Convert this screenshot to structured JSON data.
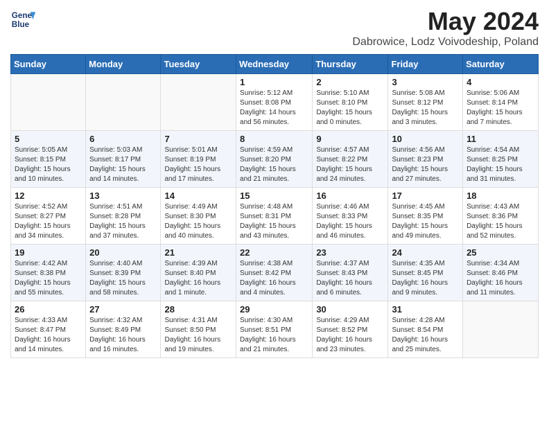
{
  "logo": {
    "line1": "General",
    "line2": "Blue"
  },
  "header": {
    "month": "May 2024",
    "location": "Dabrowice, Lodz Voivodeship, Poland"
  },
  "days_of_week": [
    "Sunday",
    "Monday",
    "Tuesday",
    "Wednesday",
    "Thursday",
    "Friday",
    "Saturday"
  ],
  "weeks": [
    [
      {
        "day": "",
        "info": ""
      },
      {
        "day": "",
        "info": ""
      },
      {
        "day": "",
        "info": ""
      },
      {
        "day": "1",
        "info": "Sunrise: 5:12 AM\nSunset: 8:08 PM\nDaylight: 14 hours\nand 56 minutes."
      },
      {
        "day": "2",
        "info": "Sunrise: 5:10 AM\nSunset: 8:10 PM\nDaylight: 15 hours\nand 0 minutes."
      },
      {
        "day": "3",
        "info": "Sunrise: 5:08 AM\nSunset: 8:12 PM\nDaylight: 15 hours\nand 3 minutes."
      },
      {
        "day": "4",
        "info": "Sunrise: 5:06 AM\nSunset: 8:14 PM\nDaylight: 15 hours\nand 7 minutes."
      }
    ],
    [
      {
        "day": "5",
        "info": "Sunrise: 5:05 AM\nSunset: 8:15 PM\nDaylight: 15 hours\nand 10 minutes."
      },
      {
        "day": "6",
        "info": "Sunrise: 5:03 AM\nSunset: 8:17 PM\nDaylight: 15 hours\nand 14 minutes."
      },
      {
        "day": "7",
        "info": "Sunrise: 5:01 AM\nSunset: 8:19 PM\nDaylight: 15 hours\nand 17 minutes."
      },
      {
        "day": "8",
        "info": "Sunrise: 4:59 AM\nSunset: 8:20 PM\nDaylight: 15 hours\nand 21 minutes."
      },
      {
        "day": "9",
        "info": "Sunrise: 4:57 AM\nSunset: 8:22 PM\nDaylight: 15 hours\nand 24 minutes."
      },
      {
        "day": "10",
        "info": "Sunrise: 4:56 AM\nSunset: 8:23 PM\nDaylight: 15 hours\nand 27 minutes."
      },
      {
        "day": "11",
        "info": "Sunrise: 4:54 AM\nSunset: 8:25 PM\nDaylight: 15 hours\nand 31 minutes."
      }
    ],
    [
      {
        "day": "12",
        "info": "Sunrise: 4:52 AM\nSunset: 8:27 PM\nDaylight: 15 hours\nand 34 minutes."
      },
      {
        "day": "13",
        "info": "Sunrise: 4:51 AM\nSunset: 8:28 PM\nDaylight: 15 hours\nand 37 minutes."
      },
      {
        "day": "14",
        "info": "Sunrise: 4:49 AM\nSunset: 8:30 PM\nDaylight: 15 hours\nand 40 minutes."
      },
      {
        "day": "15",
        "info": "Sunrise: 4:48 AM\nSunset: 8:31 PM\nDaylight: 15 hours\nand 43 minutes."
      },
      {
        "day": "16",
        "info": "Sunrise: 4:46 AM\nSunset: 8:33 PM\nDaylight: 15 hours\nand 46 minutes."
      },
      {
        "day": "17",
        "info": "Sunrise: 4:45 AM\nSunset: 8:35 PM\nDaylight: 15 hours\nand 49 minutes."
      },
      {
        "day": "18",
        "info": "Sunrise: 4:43 AM\nSunset: 8:36 PM\nDaylight: 15 hours\nand 52 minutes."
      }
    ],
    [
      {
        "day": "19",
        "info": "Sunrise: 4:42 AM\nSunset: 8:38 PM\nDaylight: 15 hours\nand 55 minutes."
      },
      {
        "day": "20",
        "info": "Sunrise: 4:40 AM\nSunset: 8:39 PM\nDaylight: 15 hours\nand 58 minutes."
      },
      {
        "day": "21",
        "info": "Sunrise: 4:39 AM\nSunset: 8:40 PM\nDaylight: 16 hours\nand 1 minute."
      },
      {
        "day": "22",
        "info": "Sunrise: 4:38 AM\nSunset: 8:42 PM\nDaylight: 16 hours\nand 4 minutes."
      },
      {
        "day": "23",
        "info": "Sunrise: 4:37 AM\nSunset: 8:43 PM\nDaylight: 16 hours\nand 6 minutes."
      },
      {
        "day": "24",
        "info": "Sunrise: 4:35 AM\nSunset: 8:45 PM\nDaylight: 16 hours\nand 9 minutes."
      },
      {
        "day": "25",
        "info": "Sunrise: 4:34 AM\nSunset: 8:46 PM\nDaylight: 16 hours\nand 11 minutes."
      }
    ],
    [
      {
        "day": "26",
        "info": "Sunrise: 4:33 AM\nSunset: 8:47 PM\nDaylight: 16 hours\nand 14 minutes."
      },
      {
        "day": "27",
        "info": "Sunrise: 4:32 AM\nSunset: 8:49 PM\nDaylight: 16 hours\nand 16 minutes."
      },
      {
        "day": "28",
        "info": "Sunrise: 4:31 AM\nSunset: 8:50 PM\nDaylight: 16 hours\nand 19 minutes."
      },
      {
        "day": "29",
        "info": "Sunrise: 4:30 AM\nSunset: 8:51 PM\nDaylight: 16 hours\nand 21 minutes."
      },
      {
        "day": "30",
        "info": "Sunrise: 4:29 AM\nSunset: 8:52 PM\nDaylight: 16 hours\nand 23 minutes."
      },
      {
        "day": "31",
        "info": "Sunrise: 4:28 AM\nSunset: 8:54 PM\nDaylight: 16 hours\nand 25 minutes."
      },
      {
        "day": "",
        "info": ""
      }
    ]
  ]
}
